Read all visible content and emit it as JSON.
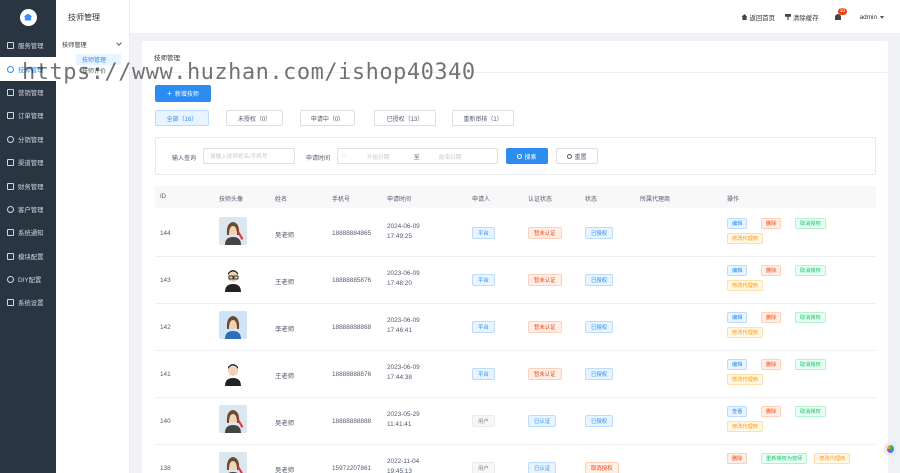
{
  "sidebar": {
    "items": [
      {
        "label": "服务管理",
        "active": false,
        "icon": "grid-icon"
      },
      {
        "label": "技师管理",
        "active": true,
        "icon": "user-icon"
      },
      {
        "label": "营销管理",
        "active": false,
        "icon": "megaphone-icon"
      },
      {
        "label": "订单管理",
        "active": false,
        "icon": "order-icon"
      },
      {
        "label": "分销管理",
        "active": false,
        "icon": "share-icon"
      },
      {
        "label": "渠道管理",
        "active": false,
        "icon": "channel-icon"
      },
      {
        "label": "财务管理",
        "active": false,
        "icon": "finance-icon"
      },
      {
        "label": "客户管理",
        "active": false,
        "icon": "customer-icon"
      },
      {
        "label": "系统通知",
        "active": false,
        "icon": "bell-icon"
      },
      {
        "label": "模块配置",
        "active": false,
        "icon": "module-icon"
      },
      {
        "label": "DIY配置",
        "active": false,
        "icon": "diy-icon"
      },
      {
        "label": "系统设置",
        "active": false,
        "icon": "settings-icon"
      }
    ]
  },
  "subpanel": {
    "title": "技师管理",
    "group": "技师管理",
    "subs": [
      "技师管理",
      "技师评价"
    ]
  },
  "header": {
    "home": "返回首页",
    "clear_cache": "清除缓存",
    "badge": "10",
    "user": "admin"
  },
  "card": {
    "title": "技师管理"
  },
  "new_button": "新增技师",
  "tabs": [
    {
      "label": "全部（16）",
      "active": true
    },
    {
      "label": "未授权（0）",
      "active": false
    },
    {
      "label": "申请中（0）",
      "active": false
    },
    {
      "label": "已授权（13）",
      "active": false
    },
    {
      "label": "重新审核（1）",
      "active": false
    }
  ],
  "filter": {
    "query_label": "输入查询",
    "query_placeholder": "请输入技师姓名/手机号",
    "time_label": "申请时间",
    "start_placeholder": "开始日期",
    "sep": "至",
    "end_placeholder": "结束日期",
    "search": "搜索",
    "reset": "重置"
  },
  "table": {
    "headers": [
      "ID",
      "技师头像",
      "姓名",
      "手机号",
      "申请时间",
      "申请人",
      "认证状态",
      "状态",
      "所属代理商",
      "操作"
    ],
    "rows": [
      {
        "id": "144",
        "avatar": "female",
        "name": "吴老师",
        "phone": "18888884865",
        "date": "2024-06-09",
        "time": "17:49:25",
        "applicant": "平台",
        "applicant_color": "blue",
        "auth": "暂未认证",
        "auth_color": "red",
        "status": "已授权",
        "status_color": "blue",
        "ops": [
          {
            "label": "编辑",
            "color": "blue"
          },
          {
            "label": "删除",
            "color": "red"
          },
          {
            "label": "取消授权",
            "color": "green"
          },
          {
            "label": "修改代理商",
            "color": "orange"
          }
        ]
      },
      {
        "id": "143",
        "avatar": "male-glasses",
        "name": "王老师",
        "phone": "18888885876",
        "date": "2023-06-09",
        "time": "17:48:20",
        "applicant": "平台",
        "applicant_color": "blue",
        "auth": "暂未认证",
        "auth_color": "red",
        "status": "已授权",
        "status_color": "blue",
        "ops": [
          {
            "label": "编辑",
            "color": "blue"
          },
          {
            "label": "删除",
            "color": "red"
          },
          {
            "label": "取消授权",
            "color": "green"
          },
          {
            "label": "修改代理商",
            "color": "orange"
          }
        ]
      },
      {
        "id": "142",
        "avatar": "female-blue",
        "name": "李老师",
        "phone": "18888888868",
        "date": "2023-06-09",
        "time": "17:46:41",
        "applicant": "平台",
        "applicant_color": "blue",
        "auth": "暂未认证",
        "auth_color": "red",
        "status": "已授权",
        "status_color": "blue",
        "ops": [
          {
            "label": "编辑",
            "color": "blue"
          },
          {
            "label": "删除",
            "color": "red"
          },
          {
            "label": "取消授权",
            "color": "green"
          },
          {
            "label": "修改代理商",
            "color": "orange"
          }
        ]
      },
      {
        "id": "141",
        "avatar": "male",
        "name": "王老师",
        "phone": "18888888876",
        "date": "2023-06-09",
        "time": "17:44:38",
        "applicant": "平台",
        "applicant_color": "blue",
        "auth": "暂未认证",
        "auth_color": "red",
        "status": "已授权",
        "status_color": "blue",
        "ops": [
          {
            "label": "编辑",
            "color": "blue"
          },
          {
            "label": "删除",
            "color": "red"
          },
          {
            "label": "取消授权",
            "color": "green"
          },
          {
            "label": "修改代理商",
            "color": "orange"
          }
        ]
      },
      {
        "id": "140",
        "avatar": "female",
        "name": "吴老师",
        "phone": "18888888888",
        "date": "2023-05-29",
        "time": "11:41:41",
        "applicant": "用户",
        "applicant_color": "grey",
        "auth": "已认证",
        "auth_color": "blue",
        "status": "已授权",
        "status_color": "blue",
        "ops": [
          {
            "label": "查看",
            "color": "blue"
          },
          {
            "label": "删除",
            "color": "red"
          },
          {
            "label": "取消授权",
            "color": "green"
          },
          {
            "label": "修改代理商",
            "color": "orange"
          }
        ]
      },
      {
        "id": "138",
        "avatar": "female",
        "name": "吴老师",
        "phone": "15972207861",
        "date": "2022-11-04",
        "time": "19:45:13",
        "applicant": "用户",
        "applicant_color": "grey",
        "auth": "已认证",
        "auth_color": "blue",
        "status": "取消授权",
        "status_color": "red",
        "ops": [
          {
            "label": "删除",
            "color": "red"
          },
          {
            "label": "重新授权为技师",
            "color": "green"
          },
          {
            "label": "修改代理商",
            "color": "orange"
          }
        ]
      }
    ]
  },
  "watermark": "https://www.huzhan.com/ishop40340"
}
